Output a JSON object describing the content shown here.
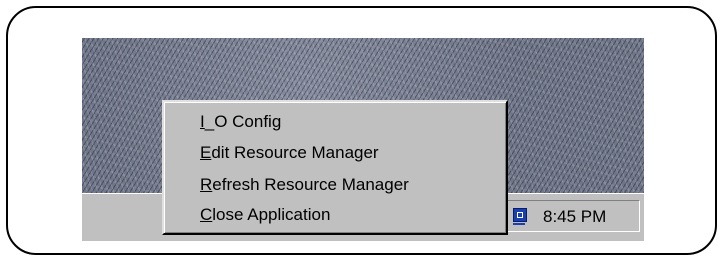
{
  "context_menu": {
    "items": [
      {
        "mnemonic": "I",
        "rest": "_O Config"
      },
      {
        "mnemonic": "E",
        "rest": "dit Resource Manager"
      },
      {
        "mnemonic": "R",
        "rest": "efresh Resource Manager"
      },
      {
        "mnemonic": "C",
        "rest": "lose Application"
      }
    ]
  },
  "taskbar": {
    "tray": {
      "clock": "8:45 PM",
      "icon": "network-tray-icon"
    }
  },
  "colors": {
    "taskbar": "#c0c0c0",
    "desktop": "#6f7688",
    "tray_icon": "#1a3fb0"
  }
}
